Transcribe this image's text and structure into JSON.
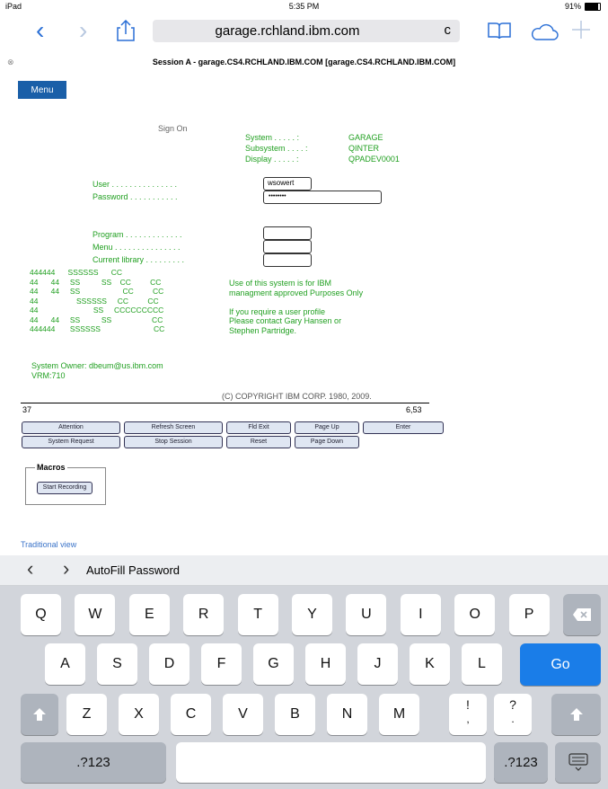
{
  "status": {
    "device": "iPad",
    "time": "5:35 PM",
    "battery": "91%"
  },
  "browser": {
    "url": "garage.rchland.ibm.com",
    "reload": "c"
  },
  "page_title": "Session A - garage.CS4.RCHLAND.IBM.COM [garage.CS4.RCHLAND.IBM.COM]",
  "menu_label": "Menu",
  "signon": {
    "heading": "Sign On",
    "system_label": "System . . . . . :",
    "system_value": "GARAGE",
    "subsystem_label": "Subsystem . . . . :",
    "subsystem_value": "QINTER",
    "display_label": "Display . . . . . :",
    "display_value": "QPADEV0001",
    "user_label": "User . . . . . . . . . . . . . . .",
    "user_value": "wsowert",
    "password_label": "Password . . . . . . . . . . .",
    "password_value": "••••••••",
    "program_label": "Program . . . . . . . . . . . . .",
    "menu_label": "Menu . . . . . . . . . . . . . . .",
    "library_label": "Current library . . . . . . . . .",
    "ascii_art": "444444      SSSSSS      CC\n44      44     SS          SS    CC         CC\n44      44     SS                    CC         CC\n44                  SSSSSS     CC         CC\n44                          SS     CCCCCCCCC\n44      44     SS          SS                   CC\n444444       SSSSSS                         CC",
    "notice": "Use of this system is for IBM\nmanagment approved Purposes Only\n\nIf you require a user profile\nPlease contact Gary Hansen or\nStephen Partridge.",
    "owner": "System Owner: dbeum@us.ibm.com",
    "vrm": "VRM:710",
    "copyright": "(C) COPYRIGHT IBM CORP. 1980, 2009.",
    "status_left": "37",
    "status_right": "6,53"
  },
  "function_buttons": {
    "attention": "Attention",
    "refresh": "Refresh Screen",
    "field_exit": "Fld Exit",
    "page_up": "Page Up",
    "enter": "Enter",
    "system_request": "System Request",
    "stop_session": "Stop Session",
    "reset": "Reset",
    "page_down": "Page Down"
  },
  "macros": {
    "label": "Macros",
    "start_recording": "Start Recording"
  },
  "traditional_view": "Traditional view",
  "autofill": {
    "label": "AutoFill Password"
  },
  "keyboard": {
    "row1": [
      "Q",
      "W",
      "E",
      "R",
      "T",
      "Y",
      "U",
      "I",
      "O",
      "P"
    ],
    "row2": [
      "A",
      "S",
      "D",
      "F",
      "G",
      "H",
      "J",
      "K",
      "L"
    ],
    "row3": [
      "Z",
      "X",
      "C",
      "V",
      "B",
      "N",
      "M"
    ],
    "go": "Go",
    "numbers": ".?123",
    "excl": "!",
    "excl_alt": ",",
    "quest": "?",
    "quest_alt": "."
  }
}
